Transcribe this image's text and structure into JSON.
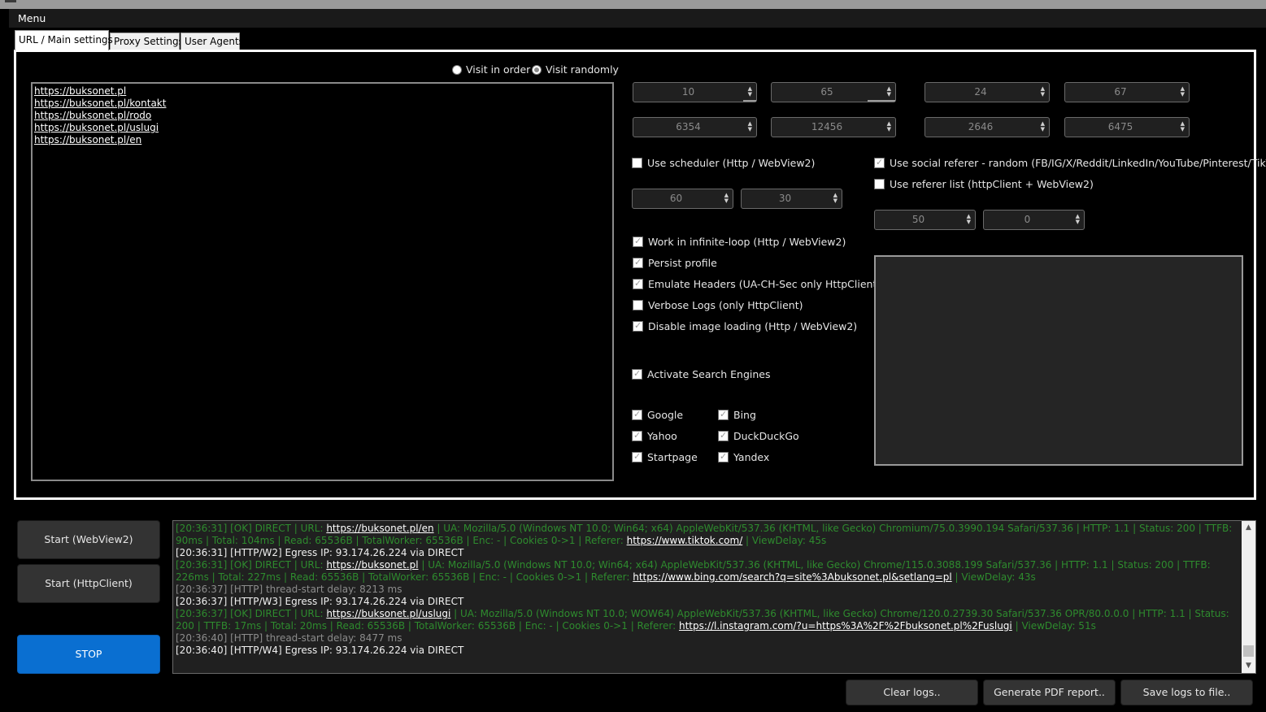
{
  "menu": {
    "label": "Menu"
  },
  "tabs": [
    {
      "label": "URL / Main settings"
    },
    {
      "label": "Proxy Settings"
    },
    {
      "label": "User Agents"
    }
  ],
  "order": {
    "in_order": "Visit in order",
    "randomly": "Visit randomly",
    "selected": "randomly"
  },
  "urls": [
    "https://buksonet.pl",
    "https://buksonet.pl/kontakt",
    "https://buksonet.pl/rodo",
    "https://buksonet.pl/uslugi",
    "https://buksonet.pl/en"
  ],
  "spinners": {
    "row1": [
      "10",
      "65",
      "24",
      "67"
    ],
    "row2": [
      "6354",
      "12456",
      "2646",
      "6475"
    ],
    "scheduler": [
      "60",
      "30"
    ],
    "referer": [
      "50",
      "0"
    ]
  },
  "options": {
    "use_scheduler": {
      "label": "Use scheduler (Http / WebView2)",
      "checked": false
    },
    "social_referer": {
      "label": "Use social referer - random (FB/IG/X/Reddit/LinkedIn/YouTube/Pinterest/TikTok)",
      "checked": true
    },
    "referer_list": {
      "label": "Use referer list (httpClient + WebView2)",
      "checked": false
    },
    "infinite_loop": {
      "label": "Work in infinite-loop (Http / WebView2)",
      "checked": true
    },
    "persist_profile": {
      "label": "Persist profile",
      "checked": true
    },
    "emulate_headers": {
      "label": "Emulate Headers (UA-CH-Sec only HttpClient)",
      "checked": true
    },
    "verbose_logs": {
      "label": "Verbose Logs (only HttpClient)",
      "checked": false
    },
    "disable_images": {
      "label": "Disable image loading (Http / WebView2)",
      "checked": true
    },
    "search_engines": {
      "label": "Activate Search Engines",
      "checked": true
    }
  },
  "engines": {
    "google": {
      "label": "Google",
      "checked": true
    },
    "bing": {
      "label": "Bing",
      "checked": true
    },
    "yahoo": {
      "label": "Yahoo",
      "checked": true
    },
    "duckduckgo": {
      "label": "DuckDuckGo",
      "checked": true
    },
    "startpage": {
      "label": "Startpage",
      "checked": true
    },
    "yandex": {
      "label": "Yandex",
      "checked": true
    }
  },
  "buttons": {
    "start_webview": "Start (WebView2)",
    "start_http": "Start (HttpClient)",
    "stop": "STOP",
    "clear_logs": "Clear logs..",
    "pdf_report": "Generate PDF report..",
    "save_logs": "Save logs to file.."
  },
  "colors": {
    "accent": "#0a6fd1",
    "log_ok": "#2e8b2e",
    "log_info": "#f0f0f0",
    "log_muted": "#8c8c8c"
  },
  "logs": [
    {
      "type": "green",
      "parts": [
        {
          "t": "[20:36:31] [OK] DIRECT | URL: "
        },
        {
          "t": "https://buksonet.pl/en",
          "link": true
        },
        {
          "t": " | UA: Mozilla/5.0 (Windows NT 10.0; Win64; x64) AppleWebKit/537.36 (KHTML, like Gecko) Chromium/75.0.3990.194 Safari/537.36 | HTTP: 1.1 | Status: 200 | TTFB: 90ms | Total: 104ms | Read: 65536B | TotalWorker: 65536B | Enc: - | Cookies 0->1 | Referer: "
        },
        {
          "t": "https://www.tiktok.com/",
          "link": true
        },
        {
          "t": " | ViewDelay: 45s"
        }
      ]
    },
    {
      "type": "white",
      "parts": [
        {
          "t": "[20:36:31] [HTTP/W2] Egress IP: 93.174.26.224 via DIRECT"
        }
      ]
    },
    {
      "type": "green",
      "parts": [
        {
          "t": "[20:36:31] [OK] DIRECT | URL: "
        },
        {
          "t": "https://buksonet.pl",
          "link": true
        },
        {
          "t": " | UA: Mozilla/5.0 (Windows NT 10.0; Win64; x64) AppleWebKit/537.36 (KHTML, like Gecko) Chrome/115.0.3088.199 Safari/537.36 | HTTP: 1.1 | Status: 200 | TTFB: 226ms | Total: 227ms | Read: 65536B | TotalWorker: 65536B | Enc: - | Cookies 0->1 | Referer: "
        },
        {
          "t": "https://www.bing.com/search?q=site%3Abuksonet.pl&setlang=pl",
          "link": true
        },
        {
          "t": " | ViewDelay: 43s"
        }
      ]
    },
    {
      "type": "gray",
      "parts": [
        {
          "t": "[20:36:37] [HTTP] thread-start delay: 8213 ms"
        }
      ]
    },
    {
      "type": "white",
      "parts": [
        {
          "t": "[20:36:37] [HTTP/W3] Egress IP: 93.174.26.224 via DIRECT"
        }
      ]
    },
    {
      "type": "green",
      "parts": [
        {
          "t": "[20:36:37] [OK] DIRECT | URL: "
        },
        {
          "t": "https://buksonet.pl/uslugi",
          "link": true
        },
        {
          "t": " | UA: Mozilla/5.0 (Windows NT 10.0; WOW64) AppleWebKit/537.36 (KHTML, like Gecko) Chrome/120.0.2739.30 Safari/537.36 OPR/80.0.0.0 | HTTP: 1.1 | Status: 200 | TTFB: 17ms | Total: 20ms | Read: 65536B | TotalWorker: 65536B | Enc: - | Cookies 0->1 | Referer: "
        },
        {
          "t": "https://l.instagram.com/?u=https%3A%2F%2Fbuksonet.pl%2Fuslugi",
          "link": true
        },
        {
          "t": " | ViewDelay: 51s"
        }
      ]
    },
    {
      "type": "gray",
      "parts": [
        {
          "t": "[20:36:40] [HTTP] thread-start delay: 8477 ms"
        }
      ]
    },
    {
      "type": "white",
      "parts": [
        {
          "t": "[20:36:40] [HTTP/W4] Egress IP: 93.174.26.224 via DIRECT"
        }
      ]
    }
  ]
}
